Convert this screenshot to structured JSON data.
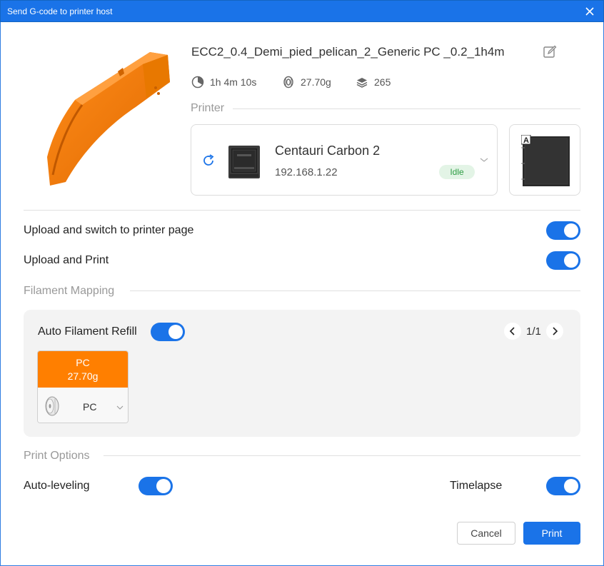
{
  "window": {
    "title": "Send G-code to printer host"
  },
  "file": {
    "name": "ECC2_0.4_Demi_pied_pelican_2_Generic PC _0.2_1h4m"
  },
  "stats": {
    "time": "1h 4m 10s",
    "weight": "27.70g",
    "layers": "265"
  },
  "printer_section": {
    "label": "Printer",
    "name": "Centauri Carbon 2",
    "ip": "192.168.1.22",
    "status": "Idle",
    "plate_label": "A"
  },
  "options": {
    "upload_switch_label": "Upload and switch to printer page",
    "upload_print_label": "Upload and Print"
  },
  "filament_mapping": {
    "label": "Filament Mapping",
    "auto_refill_label": "Auto Filament Refill",
    "pager": "1/1",
    "filament": {
      "type": "PC",
      "weight": "27.70g",
      "color": "#ff7f00",
      "selected": "PC"
    }
  },
  "print_options": {
    "label": "Print Options",
    "auto_leveling_label": "Auto-leveling",
    "timelapse_label": "Timelapse"
  },
  "buttons": {
    "cancel": "Cancel",
    "print": "Print"
  },
  "colors": {
    "accent": "#1a73e8",
    "filament": "#ff7f00",
    "status_idle": "#2e9d44"
  }
}
